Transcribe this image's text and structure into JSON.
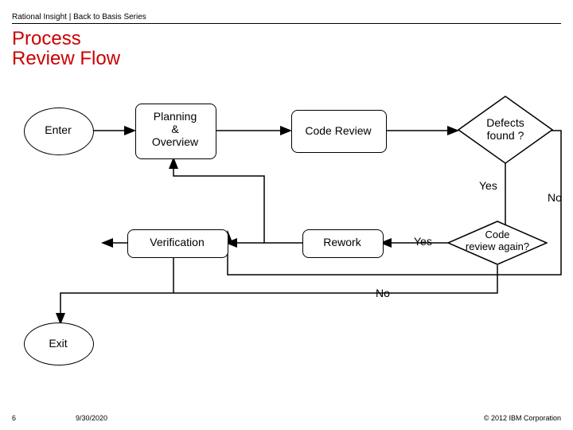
{
  "meta": {
    "header": "Rational Insight | Back to Basis Series",
    "title": "Process\nReview Flow"
  },
  "nodes": {
    "enter": "Enter",
    "planning": "Planning\n&\nOverview",
    "code_review": "Code Review",
    "defects_found": "Defects\nfound ?",
    "verification": "Verification",
    "rework": "Rework",
    "code_review_again": "Code\nreview again?",
    "exit": "Exit"
  },
  "labels": {
    "yes1": "Yes",
    "no1": "No",
    "yes2": "Yes",
    "no2": "No"
  },
  "footer": {
    "page": "6",
    "date": "9/30/2020",
    "copyright": "© 2012 IBM Corporation"
  }
}
